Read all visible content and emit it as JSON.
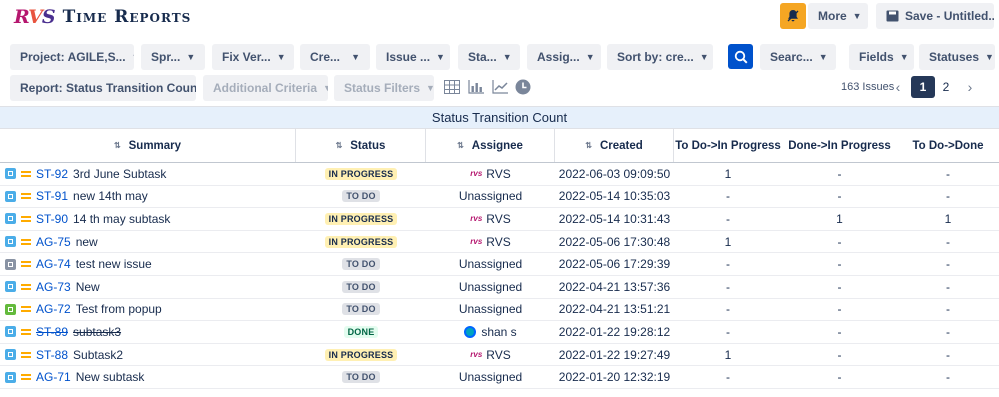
{
  "app": {
    "logo_r": "R",
    "logo_v": "V",
    "logo_s": "S",
    "title": "Time Reports"
  },
  "header": {
    "more_label": "More",
    "save_label": "Save - Untitled..."
  },
  "filters": {
    "project": "Project: AGILE,S...",
    "sprint": "Spr...",
    "fix_version": "Fix Ver...",
    "created": "Cre...",
    "issue": "Issue ...",
    "status": "Sta...",
    "assignee": "Assig...",
    "sort_by": "Sort by: cre...",
    "search": "Searc...",
    "fields": "Fields",
    "statuses": "Statuses"
  },
  "toolbar2": {
    "report": "Report: Status Transition Count",
    "additional_criteria": "Additional Criteria",
    "status_filters": "Status Filters"
  },
  "pagination": {
    "count": "163 Issues",
    "page1": "1",
    "page2": "2"
  },
  "report_title": "Status Transition Count",
  "columns": [
    "Summary",
    "Status",
    "Assignee",
    "Created",
    "To Do->In Progress",
    "Done->In Progress",
    "To Do->Done"
  ],
  "rows": [
    {
      "key": "ST-92",
      "summary": "3rd June Subtask",
      "status": "IN PROGRESS",
      "assignee": "RVS",
      "created": "2022-06-03 09:09:50",
      "t1": "1",
      "t2": "-",
      "t3": "-"
    },
    {
      "key": "ST-91",
      "summary": "new 14th may",
      "status": "TO DO",
      "assignee": "Unassigned",
      "created": "2022-05-14 10:35:03",
      "t1": "-",
      "t2": "-",
      "t3": "-"
    },
    {
      "key": "ST-90",
      "summary": "14 th may subtask",
      "status": "IN PROGRESS",
      "assignee": "RVS",
      "created": "2022-05-14 10:31:43",
      "t1": "-",
      "t2": "1",
      "t3": "1"
    },
    {
      "key": "AG-75",
      "summary": "new",
      "status": "IN PROGRESS",
      "assignee": "RVS",
      "created": "2022-05-06 17:30:48",
      "t1": "1",
      "t2": "-",
      "t3": "-"
    },
    {
      "key": "AG-74",
      "summary": "test new issue",
      "status": "TO DO",
      "assignee": "Unassigned",
      "created": "2022-05-06 17:29:39",
      "t1": "-",
      "t2": "-",
      "t3": "-"
    },
    {
      "key": "AG-73",
      "summary": "New",
      "status": "TO DO",
      "assignee": "Unassigned",
      "created": "2022-04-21 13:57:36",
      "t1": "-",
      "t2": "-",
      "t3": "-"
    },
    {
      "key": "AG-72",
      "summary": "Test from popup",
      "status": "TO DO",
      "assignee": "Unassigned",
      "created": "2022-04-21 13:51:21",
      "t1": "-",
      "t2": "-",
      "t3": "-"
    },
    {
      "key": "ST-89",
      "summary": "subtask3",
      "status": "DONE",
      "assignee": "shan s",
      "created": "2022-01-22 19:28:12",
      "t1": "-",
      "t2": "-",
      "t3": "-"
    },
    {
      "key": "ST-88",
      "summary": "Subtask2",
      "status": "IN PROGRESS",
      "assignee": "RVS",
      "created": "2022-01-22 19:27:49",
      "t1": "1",
      "t2": "-",
      "t3": "-"
    },
    {
      "key": "AG-71",
      "summary": "New subtask",
      "status": "TO DO",
      "assignee": "Unassigned",
      "created": "2022-01-20 12:32:19",
      "t1": "-",
      "t2": "-",
      "t3": "-"
    }
  ]
}
